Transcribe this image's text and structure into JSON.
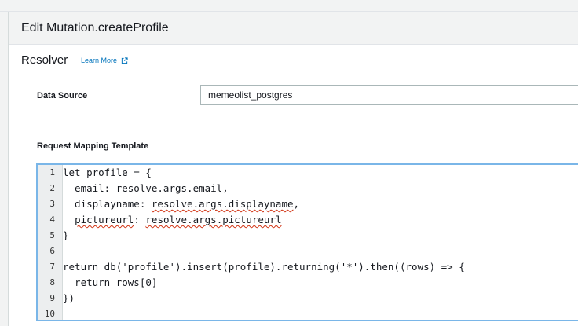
{
  "header": {
    "title": "Edit Mutation.createProfile"
  },
  "resolver": {
    "title": "Resolver",
    "learn_more": "Learn More",
    "data_source_label": "Data Source",
    "data_source_value": "memeolist_postgres",
    "request_template_label": "Request Mapping Template"
  },
  "editor": {
    "lines": [
      {
        "num": "1",
        "text": "let profile = {"
      },
      {
        "num": "2",
        "text": "  email: resolve.args.email,"
      },
      {
        "num": "3",
        "pre": "  displayname: ",
        "squig": "resolve.args.displayname",
        "post": ","
      },
      {
        "num": "4",
        "pre": "  ",
        "squig": "pictureurl",
        "mid": ": ",
        "squig2": "resolve.args.pictureurl",
        "post": ""
      },
      {
        "num": "5",
        "text": "}"
      },
      {
        "num": "6",
        "text": ""
      },
      {
        "num": "7",
        "text": "return db('profile').insert(profile).returning('*').then((rows) => {"
      },
      {
        "num": "8",
        "text": "  return rows[0]"
      },
      {
        "num": "9",
        "text": "})"
      },
      {
        "num": "10",
        "text": ""
      }
    ]
  },
  "icons": {
    "external_link": "external-link-icon"
  },
  "colors": {
    "link": "#0073bb",
    "focus_border": "#7ab6e8",
    "error_squiggle": "#d13212"
  }
}
